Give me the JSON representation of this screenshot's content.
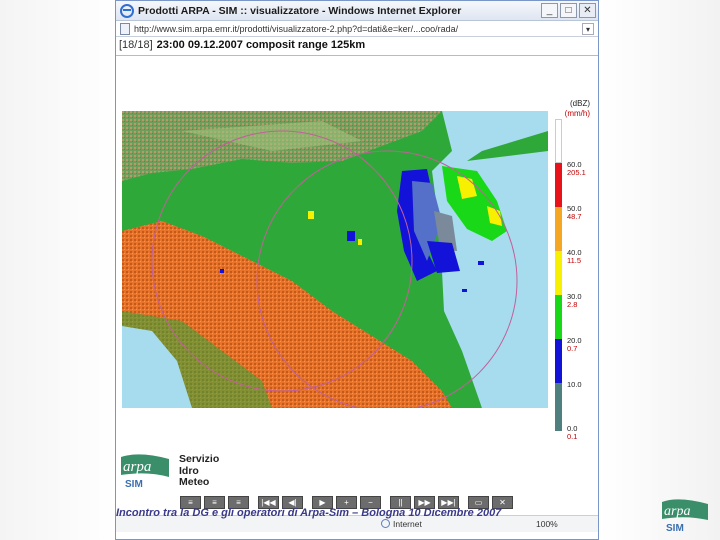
{
  "window": {
    "title": "Prodotti ARPA - SIM :: visualizzatore - Windows Internet Explorer",
    "url": "http://www.sim.arpa.emr.it/prodotti/visualizzatore-2.php?d=dati&e=ker/...coo/rada/"
  },
  "radar": {
    "frames": "[18/18]",
    "timestamp": "23:00 09.12.2007 composit range 125km"
  },
  "legend": {
    "unit_dbz": "(dBZ)",
    "unit_rate": "(mm/h)",
    "scale": [
      {
        "dbz": "60.0",
        "mmh": "205.1",
        "color": "#ffffff"
      },
      {
        "dbz": "50.0",
        "mmh": "48.7",
        "color": "#e8121a"
      },
      {
        "dbz": "40.0",
        "mmh": "11.5",
        "color": "#f5a623"
      },
      {
        "dbz": "30.0",
        "mmh": "2.8",
        "color": "#f7f000"
      },
      {
        "dbz": "20.0",
        "mmh": "0.7",
        "color": "#18d818"
      },
      {
        "dbz": "10.0",
        "mmh": "",
        "color": "#1212d8"
      },
      {
        "dbz": "0.0",
        "mmh": "0.1",
        "color": "#4f7f7f"
      }
    ]
  },
  "branding": {
    "arpa": "arpa",
    "sim": "SIM",
    "servizio_lines": [
      "Servizio",
      "Idro",
      "Meteo"
    ]
  },
  "controls": [
    "≡",
    "≡",
    "≡",
    "|◀◀",
    "◀|",
    "▶",
    "+",
    "−",
    "||",
    "▶▶",
    "▶▶|",
    "▭",
    "✕"
  ],
  "statusbar": {
    "zone": "Internet",
    "zoom": "100%"
  },
  "footer": {
    "caption": "Incontro tra la DG e gli operatori di Arpa-Sim – Bologna 10 Dicembre 2007"
  },
  "colors": {
    "sea": "#a7dcef",
    "plain": "#2fa83a",
    "mountains": "#e8732a",
    "radar_ring": "#c0609a",
    "window_border": "#7a96c8"
  }
}
